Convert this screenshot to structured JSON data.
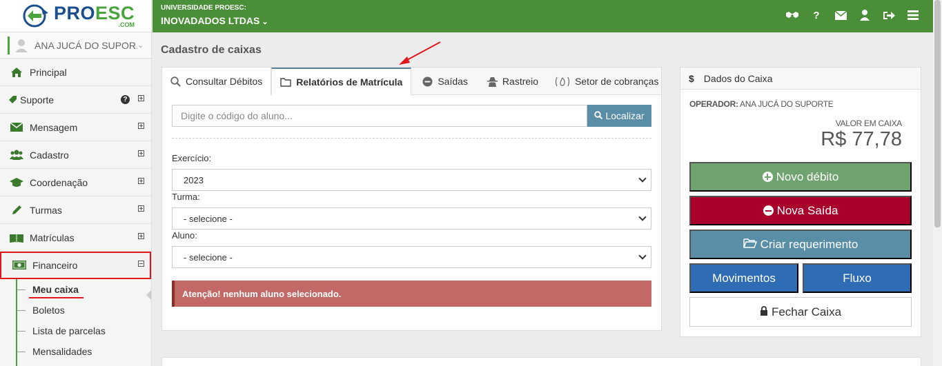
{
  "brand": {
    "name_part1": "PRO",
    "name_part2": "ESC",
    "suffix": ".COM"
  },
  "user": {
    "name": "ANA JUCÁ DO SUPOR..."
  },
  "sidebar": {
    "items": [
      {
        "label": "Principal",
        "icon": "home-icon"
      },
      {
        "label": "Suporte",
        "icon": "tag-icon"
      },
      {
        "label": "Mensagem",
        "icon": "envelope-icon"
      },
      {
        "label": "Cadastro",
        "icon": "users-icon"
      },
      {
        "label": "Coordenação",
        "icon": "graduation-cap-icon"
      },
      {
        "label": "Turmas",
        "icon": "pencil-icon"
      },
      {
        "label": "Matrículas",
        "icon": "book-icon"
      },
      {
        "label": "Financeiro",
        "icon": "money-icon"
      }
    ],
    "submenu": [
      "Meu caixa",
      "Boletos",
      "Lista de parcelas",
      "Mensalidades"
    ]
  },
  "topbar": {
    "org_label": "UNIVERSIDADE PROESC:",
    "org_name": "INOVADADOS LTDAS"
  },
  "main": {
    "title": "Cadastro de caixas",
    "tabs": [
      {
        "label": "Consultar Débitos"
      },
      {
        "label": "Relatórios de Matrícula"
      },
      {
        "label": "Saídas"
      },
      {
        "label": "Rastreio"
      },
      {
        "label": "Setor de cobranças"
      }
    ],
    "search": {
      "placeholder": "Digite o código do aluno...",
      "button": "Localizar"
    },
    "exercicio": {
      "label": "Exercício:",
      "value": "2023"
    },
    "turma": {
      "label": "Turma:",
      "value": "- selecione -"
    },
    "aluno": {
      "label": "Aluno:",
      "value": "- selecione -"
    },
    "alert": "Atenção! nenhum aluno selecionado."
  },
  "cashbox": {
    "title": "Dados do Caixa",
    "operator_label": "OPERADOR:",
    "operator_name": "ANA JUCÁ DO SUPORTE",
    "value_label": "VALOR EM CAIXA",
    "value": "R$ 77,78",
    "buttons": {
      "novo_debito": "Novo débito",
      "nova_saida": "Nova Saída",
      "criar_requerimento": "Criar requerimento",
      "movimentos": "Movimentos",
      "fluxo": "Fluxo",
      "fechar_caixa": "Fechar Caixa"
    }
  },
  "colors": {
    "topbar": "#4a8e38",
    "accent_green": "#6fa36f",
    "danger": "#a8002b",
    "teal": "#5a8ea6",
    "blue": "#2e6db4",
    "highlight_red": "#e0161b"
  }
}
